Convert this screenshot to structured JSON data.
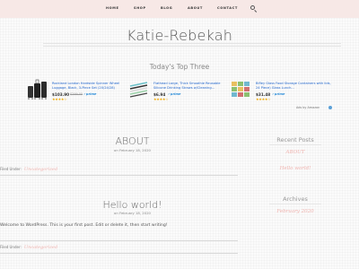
{
  "nav": {
    "items": [
      "HOME",
      "SHOP",
      "BLOG",
      "ABOUT",
      "CONTACT"
    ]
  },
  "site": {
    "title": "Katie-Rebekah"
  },
  "ads": {
    "section_title": "Today's Top Three",
    "products": [
      {
        "title": "Rockland London Hardside Spinner Wheel Luggage, Black, 3-Piece Set (20/24/28)",
        "price": "$103.90",
        "old_price": "$299.00",
        "prime": "✓prime",
        "stars": "★★★★☆"
      },
      {
        "title": "Flathead Large, Thick Smoothie Reusable Silicone Drinking Straws w/Cleaning...",
        "price": "$6.94",
        "prime": "✓prime",
        "stars": "★★★★☆"
      },
      {
        "title": "Bifley Glass Food Storage Containers with lids, 24 Piece) Glass Lunch...",
        "price": "$31.48",
        "prime": "✓prime",
        "stars": "★★★★☆"
      }
    ],
    "ads_by": "Ads by Amazon"
  },
  "posts": [
    {
      "title": "ABOUT",
      "date": "on February 18, 2020",
      "filed_label": "Filed Under:",
      "category": "Uncategorized"
    },
    {
      "title": "Hello world!",
      "date": "on February 18, 2020",
      "content": "Welcome to WordPress. This is your first post. Edit or delete it, then start writing!",
      "filed_label": "Filed Under:",
      "category": "Uncategorized"
    }
  ],
  "sidebar": {
    "recent_title": "Recent Posts",
    "recent": [
      "ABOUT",
      "Hello world!"
    ],
    "archives_title": "Archives",
    "archive_month": "February 2020"
  },
  "colors": {
    "nav_bg": "#f7e8e6",
    "accent": "#f0b4b0",
    "link": "#2266cc",
    "star": "#f0a800"
  }
}
